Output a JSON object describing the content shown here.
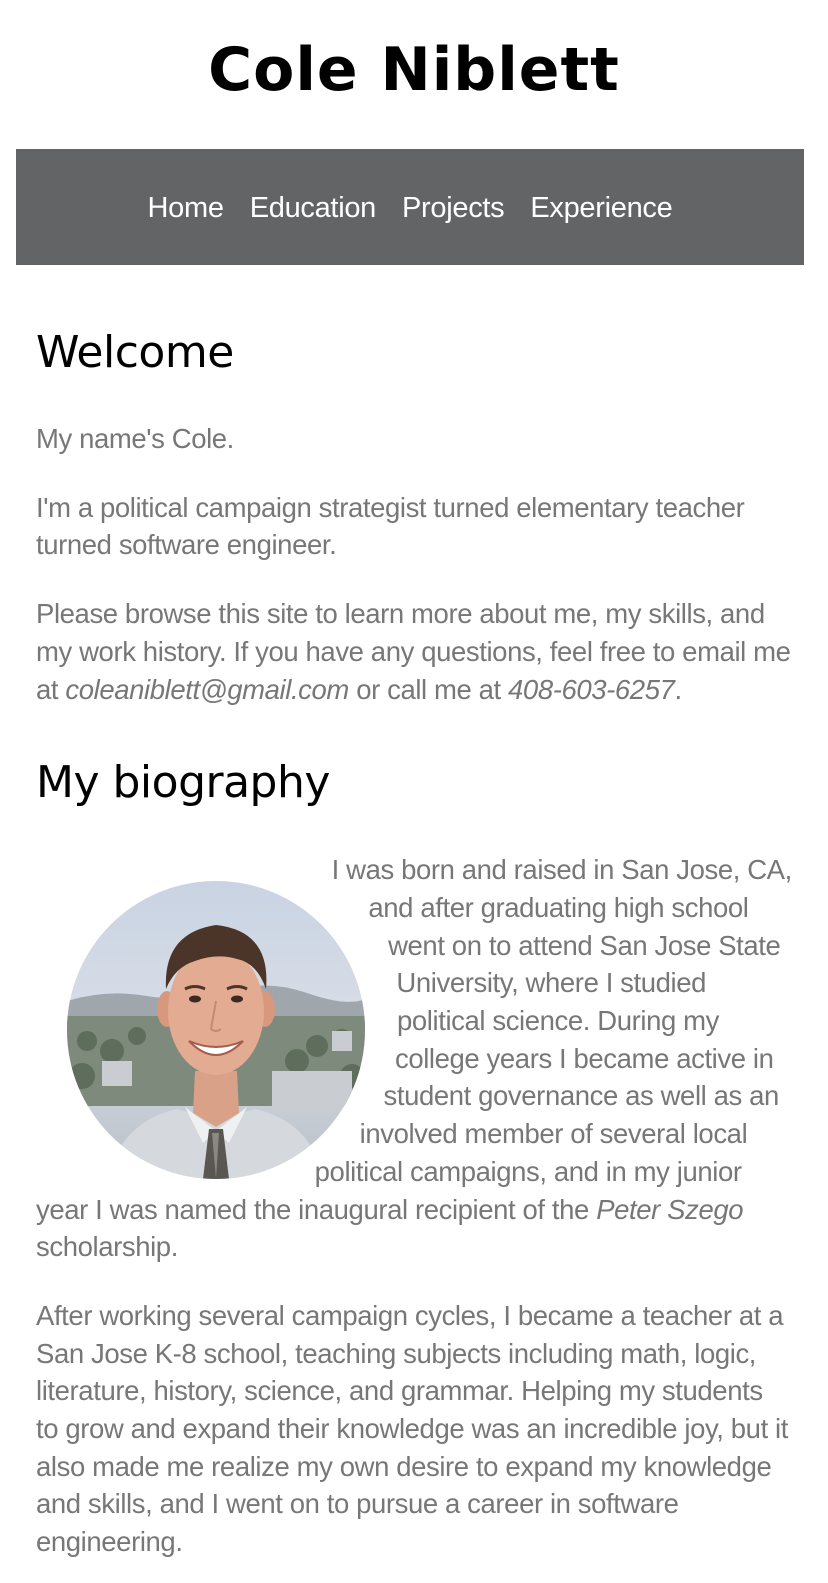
{
  "site": {
    "title": "Cole Niblett"
  },
  "nav": {
    "items": [
      "Home",
      "Education",
      "Projects",
      "Experience"
    ]
  },
  "welcome": {
    "heading": "Welcome",
    "p1": "My name's Cole.",
    "p2": "I'm a political campaign strategist turned elementary teacher turned software engineer.",
    "p3_lead": "Please browse this site to learn more about me, my skills, and my work history. If you have any questions, feel free to email me at",
    "email": "coleaniblett@gmail.com",
    "p3_mid": "or call me at",
    "phone": "408-603-6257",
    "p3_end": "."
  },
  "biography": {
    "heading": "My biography",
    "p1_lead": "I was born and raised in San Jose, CA, and after graduating high school went on to attend San Jose State University, where I studied political science. During my college years I became active in student governance as well as an involved member of several local political campaigns, and in my junior year I was named the inaugural recipient of the",
    "scholarship_name": "Peter Szego",
    "p1_end": "scholarship.",
    "p2": "After working several campaign cycles, I became a teacher at a San Jose K-8 school, teaching subjects including math, logic, literature, history, science, and grammar. Helping my students to grow and expand their knowledge was an incredible joy, but it also made me realize my own desire to expand my knowledge and skills, and I went on to pursue a career in software engineering."
  },
  "colors": {
    "nav_background": "#636466",
    "body_text": "#777777",
    "heading_text": "#000000"
  }
}
